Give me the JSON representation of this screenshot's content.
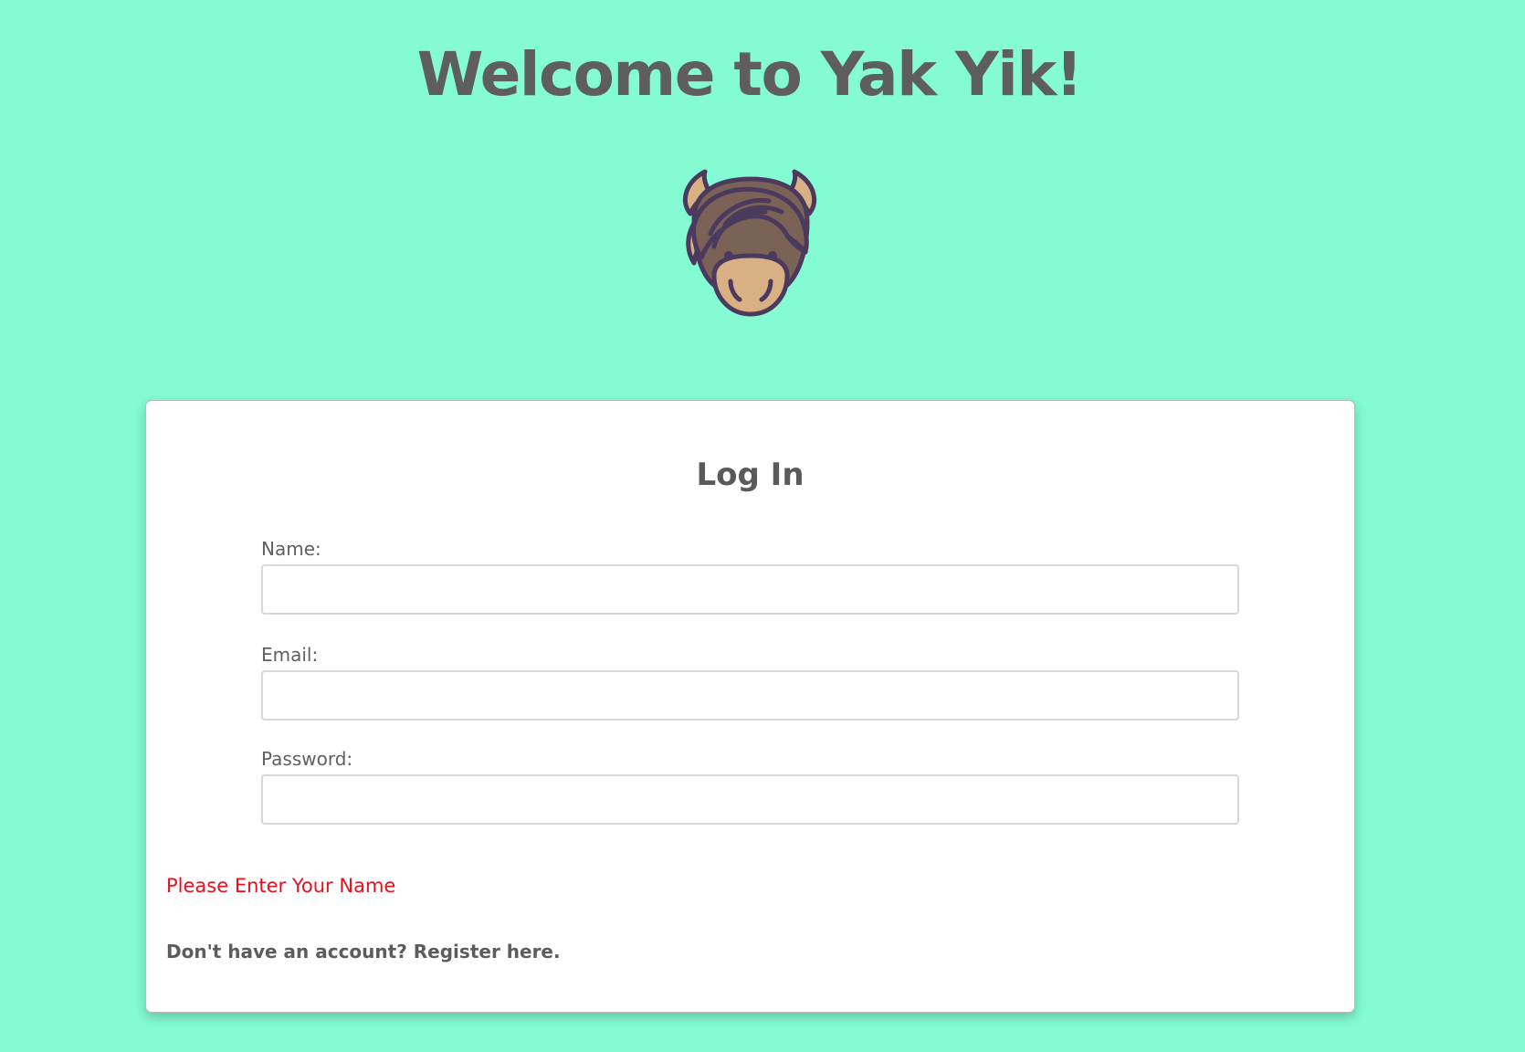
{
  "header": {
    "title": "Welcome to Yak Yik!",
    "logo_icon": "yak-head-icon"
  },
  "login_card": {
    "title": "Log In",
    "fields": {
      "name": {
        "label": "Name:",
        "value": "",
        "placeholder": ""
      },
      "email": {
        "label": "Email:",
        "value": "",
        "placeholder": ""
      },
      "password": {
        "label": "Password:",
        "value": "",
        "placeholder": ""
      }
    },
    "error_message": "Please Enter Your Name",
    "register_prompt": "Don't have an account? Register here."
  },
  "colors": {
    "background": "#84fbd3",
    "error": "#e8101f",
    "text": "#5f5f5f"
  }
}
